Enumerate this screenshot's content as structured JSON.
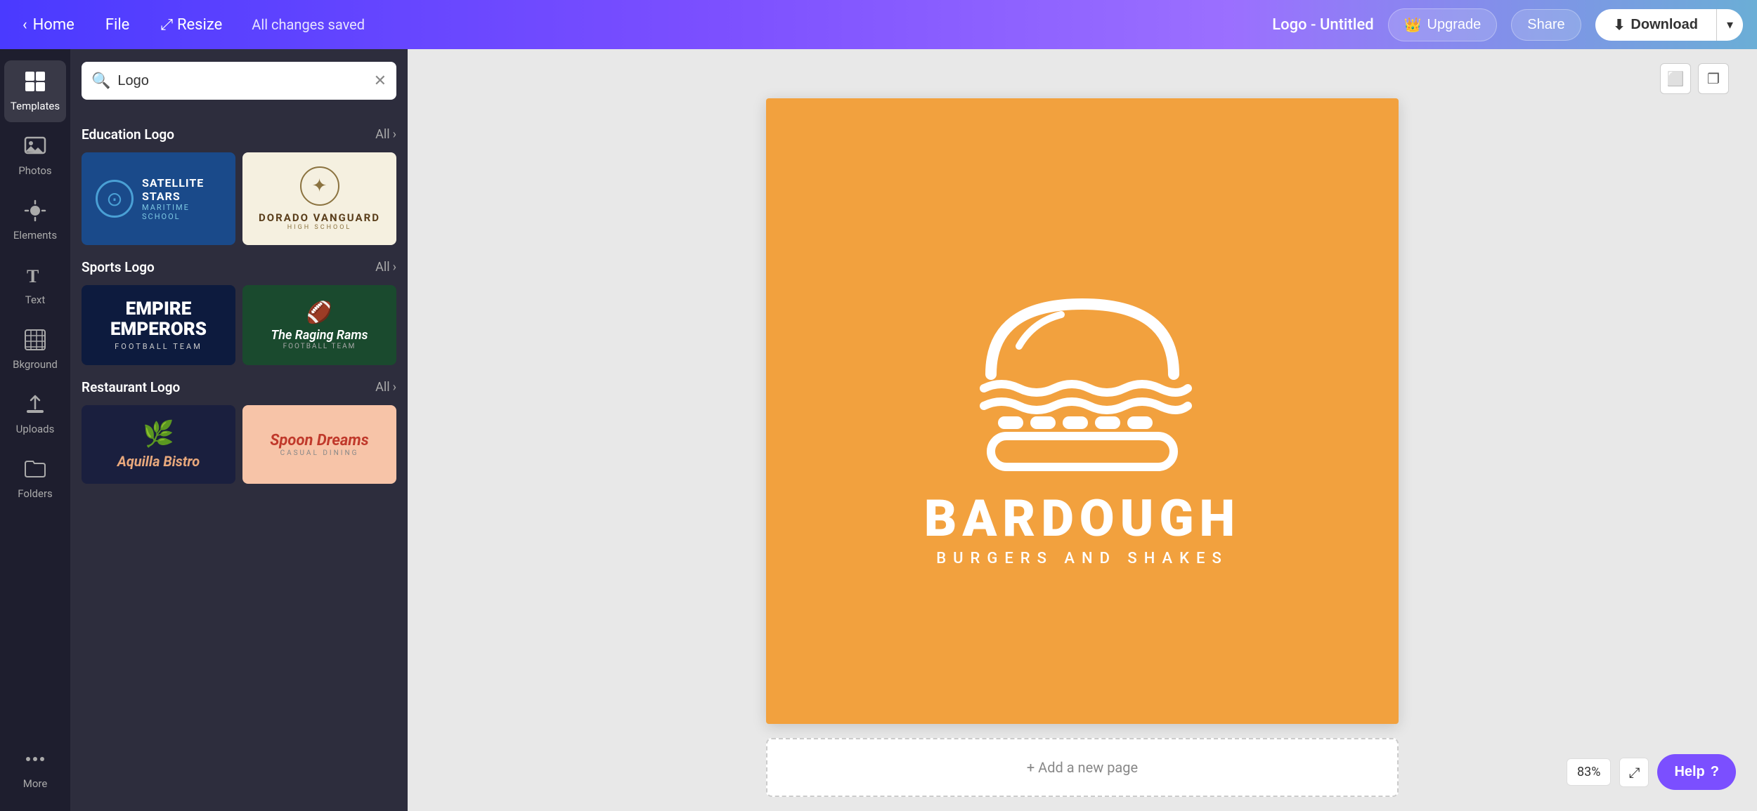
{
  "nav": {
    "home_label": "Home",
    "file_label": "File",
    "resize_label": "Resize",
    "saved_text": "All changes saved",
    "logo_title": "Logo - Untitled",
    "upgrade_label": "Upgrade",
    "share_label": "Share",
    "download_label": "Download"
  },
  "sidebar_icons": [
    {
      "id": "templates",
      "label": "Templates",
      "icon": "⊞",
      "active": true
    },
    {
      "id": "photos",
      "label": "Photos",
      "icon": "🖼"
    },
    {
      "id": "elements",
      "label": "Elements",
      "icon": "✦"
    },
    {
      "id": "text",
      "label": "Text",
      "icon": "T"
    },
    {
      "id": "background",
      "label": "Bkground",
      "icon": "▦"
    },
    {
      "id": "uploads",
      "label": "Uploads",
      "icon": "↑"
    },
    {
      "id": "folders",
      "label": "Folders",
      "icon": "📁"
    },
    {
      "id": "more",
      "label": "More",
      "icon": "···"
    }
  ],
  "search": {
    "placeholder": "Logo",
    "value": "Logo"
  },
  "sections": [
    {
      "id": "education",
      "title": "Education Logo",
      "all_label": "All",
      "cards": [
        {
          "id": "satellite",
          "name": "Satellite Stars Maritime School"
        },
        {
          "id": "dorado",
          "name": "Dorado Vanguard High School"
        }
      ]
    },
    {
      "id": "sports",
      "title": "Sports Logo",
      "all_label": "All",
      "cards": [
        {
          "id": "empire",
          "name": "Empire Emperors Football Team"
        },
        {
          "id": "rams",
          "name": "The Raging Rams Football Team"
        }
      ]
    },
    {
      "id": "restaurant",
      "title": "Restaurant Logo",
      "all_label": "All",
      "cards": [
        {
          "id": "aquilla",
          "name": "Aquilla Bistro"
        },
        {
          "id": "spoon",
          "name": "Spoon Dreams Casual Dining"
        }
      ]
    }
  ],
  "canvas": {
    "brand_main": "BARDOUGH",
    "brand_sub": "BURGERS AND SHAKES",
    "add_page_label": "+ Add a new page",
    "zoom": "83%"
  },
  "help": {
    "label": "Help",
    "icon": "?"
  }
}
